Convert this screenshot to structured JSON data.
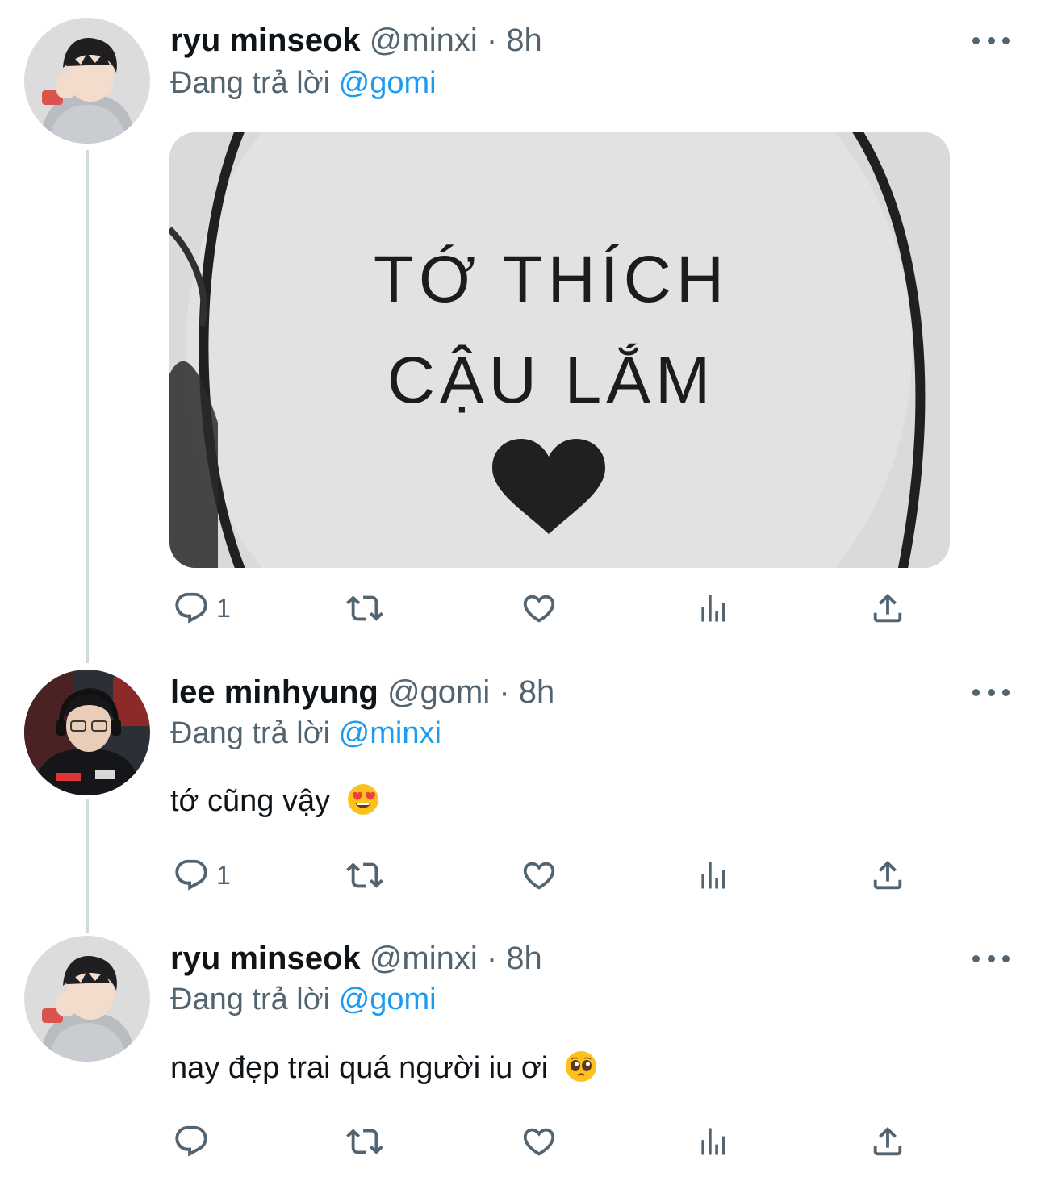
{
  "tweets": [
    {
      "display_name": "ryu minseok",
      "handle": "@minxi",
      "time": "· 8h",
      "reply_prefix": "Đang trả lời",
      "reply_to": "@gomi",
      "media_text_line1": "TỚ THÍCH",
      "media_text_line2": "CẬU LẮM",
      "reply_count": "1"
    },
    {
      "display_name": "lee minhyung",
      "handle": "@gomi",
      "time": "· 8h",
      "reply_prefix": "Đang trả lời",
      "reply_to": "@minxi",
      "text": "tớ cũng vậy",
      "emoji": "heart-eyes-emoji",
      "reply_count": "1"
    },
    {
      "display_name": "ryu minseok",
      "handle": "@minxi",
      "time": "· 8h",
      "reply_prefix": "Đang trả lời",
      "reply_to": "@gomi",
      "text": "nay đẹp trai quá người iu ơi",
      "emoji": "pleading-face-emoji",
      "reply_count": ""
    }
  ],
  "icons": [
    "more-icon",
    "reply-icon",
    "retweet-icon",
    "like-icon",
    "views-icon",
    "share-icon"
  ],
  "colors": {
    "text": "#0f1419",
    "secondary": "#536471",
    "link": "#1d9bf0",
    "thread_line": "#cfd9de"
  }
}
